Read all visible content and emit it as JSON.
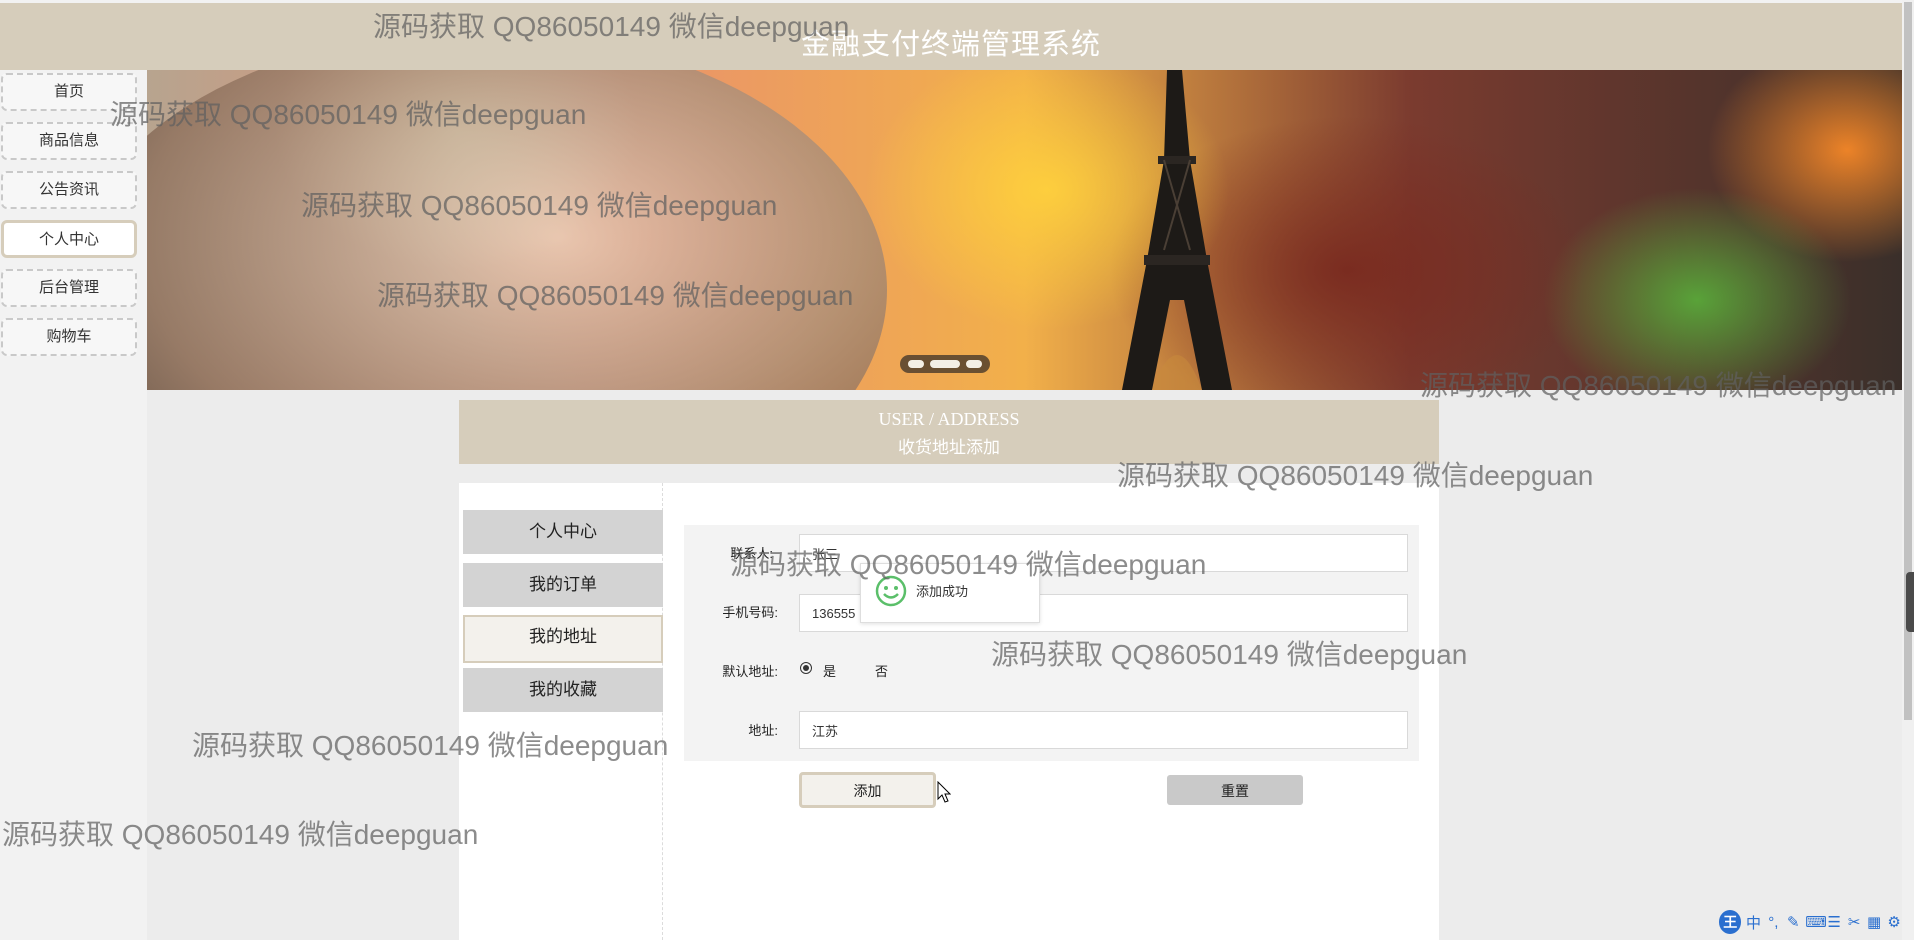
{
  "header": {
    "title": "金融支付终端管理系统"
  },
  "nav": {
    "items": [
      {
        "label": "首页"
      },
      {
        "label": "商品信息"
      },
      {
        "label": "公告资讯"
      },
      {
        "label": "个人中心"
      },
      {
        "label": "后台管理"
      },
      {
        "label": "购物车"
      }
    ],
    "active": "个人中心"
  },
  "section": {
    "title_en": "USER / ADDRESS",
    "title_cn": "收货地址添加"
  },
  "sidebar": {
    "items": [
      {
        "label": "个人中心"
      },
      {
        "label": "我的订单"
      },
      {
        "label": "我的地址"
      },
      {
        "label": "我的收藏"
      }
    ],
    "active": "我的地址"
  },
  "form": {
    "contact_label": "联系人:",
    "contact_value": "张三",
    "phone_label": "手机号码:",
    "phone_value": "136555",
    "default_label": "默认地址:",
    "default_yes": "是",
    "default_no": "否",
    "default_selected": "是",
    "address_label": "地址:",
    "address_value": "江苏",
    "add_button": "添加",
    "reset_button": "重置"
  },
  "toast": {
    "message": "添加成功"
  },
  "watermark": {
    "text": "源码获取 QQ86050149 微信deepguan"
  },
  "ime": {
    "logo": "王",
    "items": [
      "中",
      "°,",
      "✎",
      "⌨",
      "☰",
      "✂",
      "▦",
      "⚙"
    ]
  },
  "colors": {
    "accent": "#d6cdbb",
    "nav_bg": "#f2f2f2",
    "panel_bg": "#ffffff",
    "form_bg": "#f3f3f3"
  }
}
